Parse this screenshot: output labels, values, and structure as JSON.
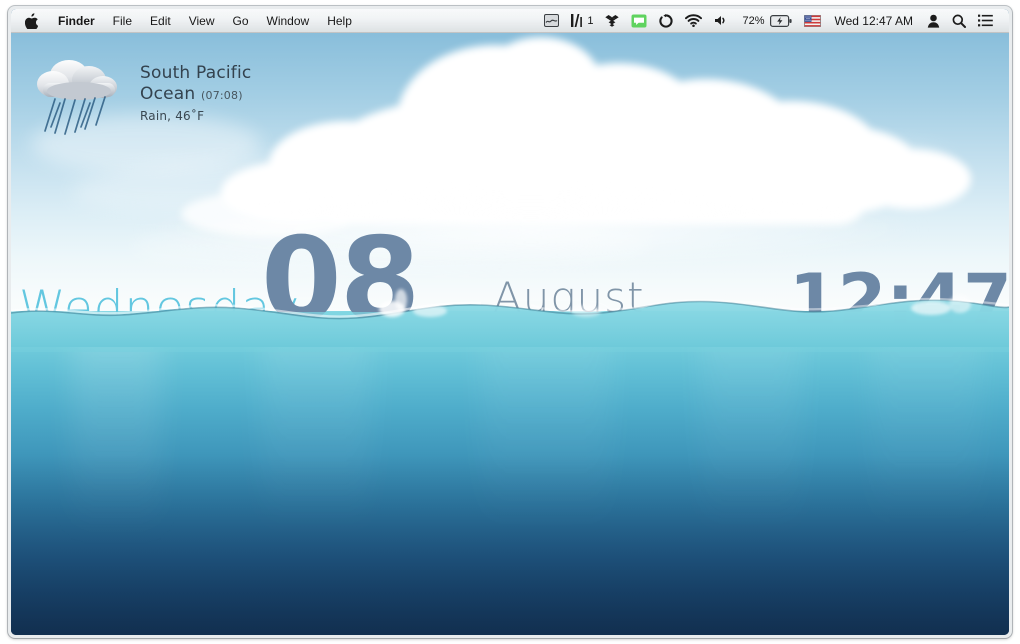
{
  "menubar": {
    "apple_icon": "apple-logo-icon",
    "items": [
      {
        "label": "Finder",
        "bold": true
      },
      {
        "label": "File",
        "bold": false
      },
      {
        "label": "Edit",
        "bold": false
      },
      {
        "label": "View",
        "bold": false
      },
      {
        "label": "Go",
        "bold": false
      },
      {
        "label": "Window",
        "bold": false
      },
      {
        "label": "Help",
        "bold": false
      }
    ],
    "status": {
      "screenshot_icon": "screenshot-icon",
      "audio_meter_icon": "audio-input-meter-icon",
      "audio_meter_value": "1",
      "dropbox_icon": "dropbox-icon",
      "messages_icon": "messages-bubble-icon",
      "sync_icon": "sync-refresh-icon",
      "wifi_icon": "wifi-icon",
      "volume_icon": "volume-speaker-icon",
      "battery_percent": "72%",
      "battery_icon": "battery-charging-icon",
      "flag_icon": "us-flag-input-icon",
      "clock": "Wed 12:47 AM",
      "user_icon": "user-account-icon",
      "spotlight_icon": "search-icon",
      "notification_center_icon": "notification-center-icon"
    }
  },
  "weather": {
    "icon": "rain-cloud-icon",
    "city": "South Pacific Ocean",
    "local_time": "(07:08)",
    "condition": "Rain, 46˚F"
  },
  "overlay": {
    "weekday": "Wednesday",
    "day": "08",
    "month": "August",
    "time": "12:47"
  },
  "colors": {
    "sky_top": "#7fb4d4",
    "sky_horizon": "#fbfdfd",
    "water_top": "#7ed5e2",
    "water_bottom": "#193a5e",
    "overlay_digits": "#6d88a6",
    "overlay_weekday": "#63c7e0",
    "overlay_month": "#8095a8",
    "messages_green": "#5fd35f",
    "menubar_bg": "#f7f7f7"
  }
}
